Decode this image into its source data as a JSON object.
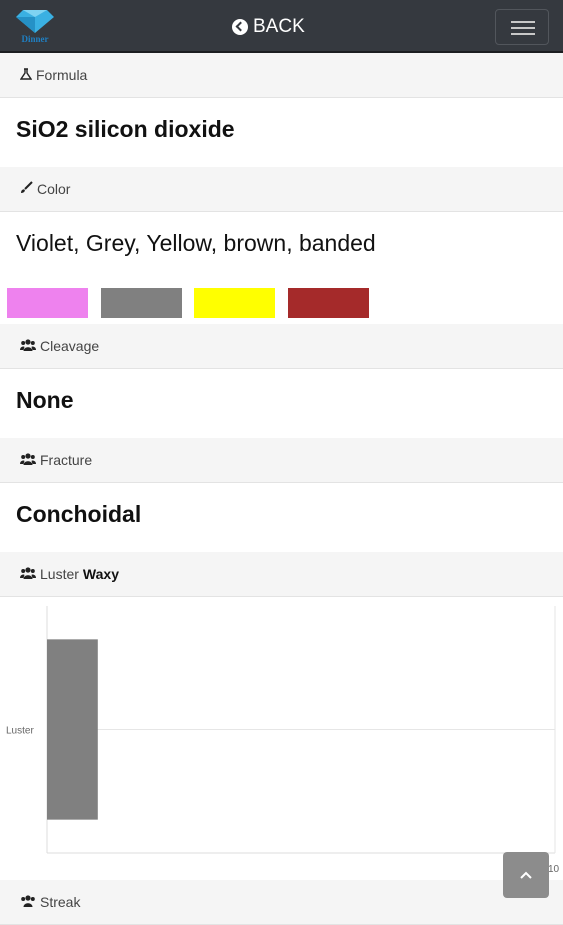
{
  "header": {
    "back_label": "BACK",
    "logo_text": "Dinner"
  },
  "sections": {
    "formula": {
      "label": "Formula",
      "value": "SiO2 silicon dioxide"
    },
    "color": {
      "label": "Color",
      "value": "Violet, Grey, Yellow, brown, banded",
      "swatches": [
        "#ee82ee",
        "#808080",
        "#ffff00",
        "#a52a2a"
      ]
    },
    "cleavage": {
      "label": "Cleavage",
      "value": "None"
    },
    "fracture": {
      "label": "Fracture",
      "value": "Conchoidal"
    },
    "luster": {
      "label": "Luster",
      "value": "Waxy"
    },
    "streak": {
      "label": "Streak"
    }
  },
  "chart_data": {
    "type": "bar",
    "orientation": "horizontal",
    "categories": [
      "Luster"
    ],
    "values": [
      1
    ],
    "xlim": [
      0,
      10
    ],
    "x_tick_labels": [
      "10"
    ],
    "bar_color": "#808080",
    "grid": true
  }
}
